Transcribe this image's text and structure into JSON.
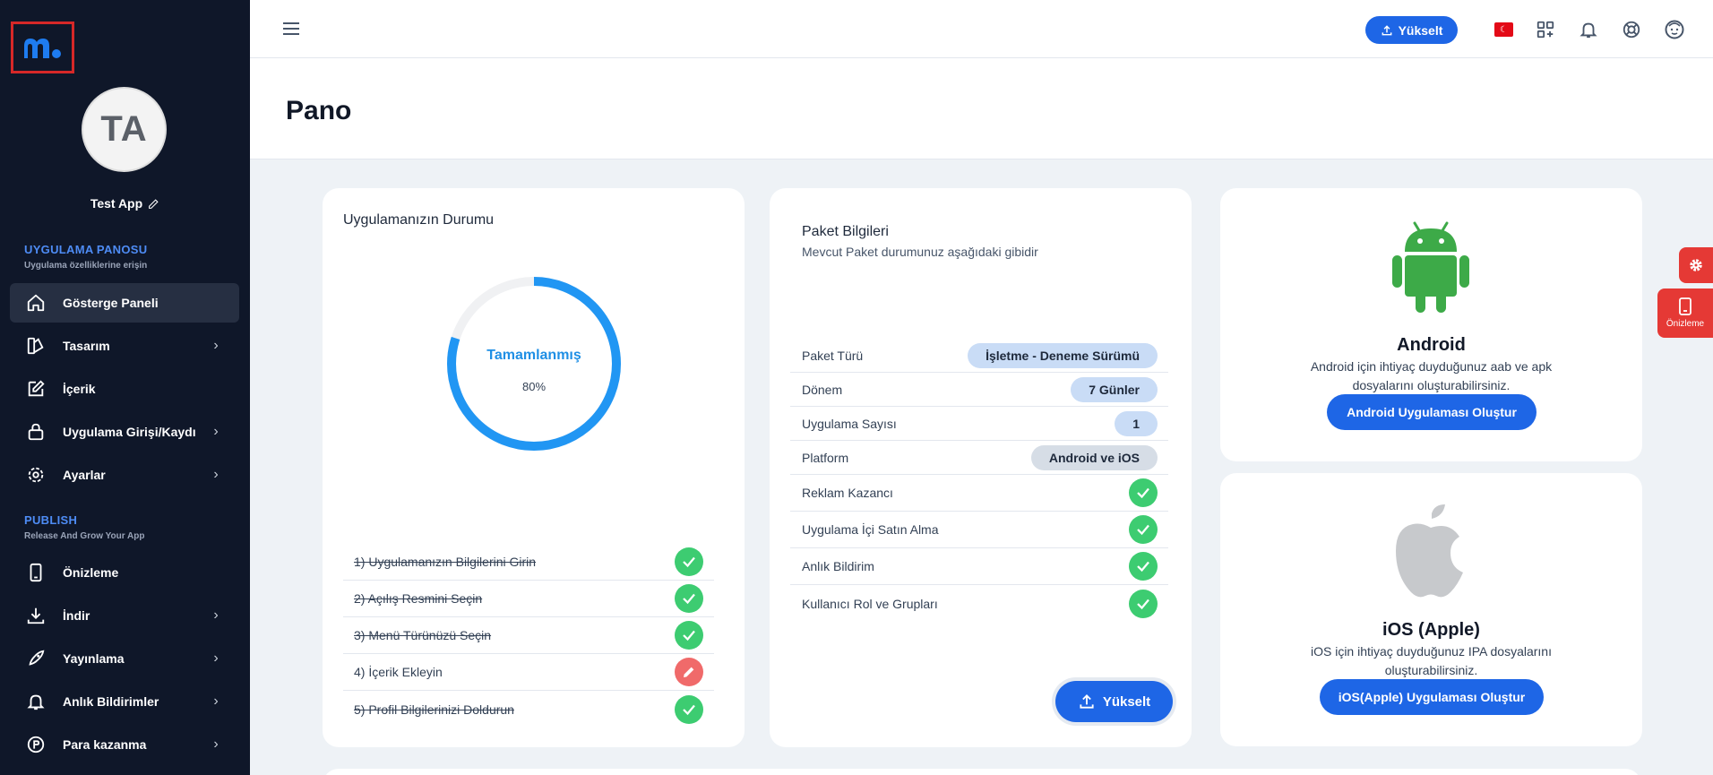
{
  "sidebar": {
    "avatar_initials": "TA",
    "app_name": "Test App",
    "section1": {
      "title": "UYGULAMA PANOSU",
      "subtitle": "Uygulama özelliklerine erişin"
    },
    "section2": {
      "title": "PUBLISH",
      "subtitle": "Release And Grow Your App"
    },
    "items": [
      {
        "label": "Gösterge Paneli",
        "icon": "home-icon",
        "chevron": false,
        "active": true
      },
      {
        "label": "Tasarım",
        "icon": "design-icon",
        "chevron": true
      },
      {
        "label": "İçerik",
        "icon": "edit-icon",
        "chevron": false
      },
      {
        "label": "Uygulama Girişi/Kaydı",
        "icon": "lock-icon",
        "chevron": true
      },
      {
        "label": "Ayarlar",
        "icon": "gear-icon",
        "chevron": true
      },
      {
        "label": "Önizleme",
        "icon": "phone-icon",
        "chevron": false
      },
      {
        "label": "İndir",
        "icon": "download-icon",
        "chevron": true
      },
      {
        "label": "Yayınlama",
        "icon": "rocket-icon",
        "chevron": true
      },
      {
        "label": "Anlık Bildirimler",
        "icon": "bell-icon",
        "chevron": true
      },
      {
        "label": "Para kazanma",
        "icon": "money-icon",
        "chevron": true
      }
    ]
  },
  "topbar": {
    "upgrade_label": "Yükselt"
  },
  "page": {
    "title": "Pano"
  },
  "status_card": {
    "title": "Uygulamanızın Durumu",
    "donut_label": "Tamamlanmış",
    "progress_percent_text": "80%",
    "progress": 0.8,
    "steps": [
      {
        "label": "1) Uygulamanızın Bilgilerini Girin",
        "done": true
      },
      {
        "label": "2) Açılış Resmini Seçin",
        "done": true
      },
      {
        "label": "3) Menü Türünüzü Seçin",
        "done": true
      },
      {
        "label": "4) İçerik Ekleyin",
        "done": false
      },
      {
        "label": "5) Profil Bilgilerinizi Doldurun",
        "done": true
      }
    ]
  },
  "package_card": {
    "title": "Paket Bilgileri",
    "subtitle": "Mevcut Paket durumunuz aşağıdaki gibidir",
    "rows": [
      {
        "key": "Paket Türü",
        "value": "İşletme - Deneme Sürümü",
        "type": "pill"
      },
      {
        "key": "Dönem",
        "value": "7 Günler",
        "type": "pill"
      },
      {
        "key": "Uygulama Sayısı",
        "value": "1",
        "type": "pill"
      },
      {
        "key": "Platform",
        "value": "Android ve iOS",
        "type": "pill-grey"
      },
      {
        "key": "Reklam Kazancı",
        "type": "check"
      },
      {
        "key": "Uygulama İçi Satın Alma",
        "type": "check"
      },
      {
        "key": "Anlık Bildirim",
        "type": "check"
      },
      {
        "key": "Kullanıcı Rol ve Grupları",
        "type": "check"
      }
    ],
    "upgrade_label": "Yükselt"
  },
  "android_card": {
    "name": "Android",
    "description": "Android için ihtiyaç duyduğunuz aab ve apk dosyalarını oluşturabilirsiniz.",
    "button_label": "Android Uygulaması Oluştur",
    "icon": "android-icon",
    "color": "#3daa48"
  },
  "ios_card": {
    "name": "iOS (Apple)",
    "description": "iOS için ihtiyaç duyduğunuz IPA dosyalarını oluşturabilirsiniz.",
    "button_label": "iOS(Apple) Uygulaması Oluştur",
    "icon": "apple-icon",
    "color": "#c7c9cc"
  },
  "floating": {
    "preview_label": "Önizleme"
  },
  "colors": {
    "accent": "#1e66e6",
    "success": "#3dcc71",
    "danger": "#e53935",
    "sidebar_bg": "#0f1729"
  }
}
